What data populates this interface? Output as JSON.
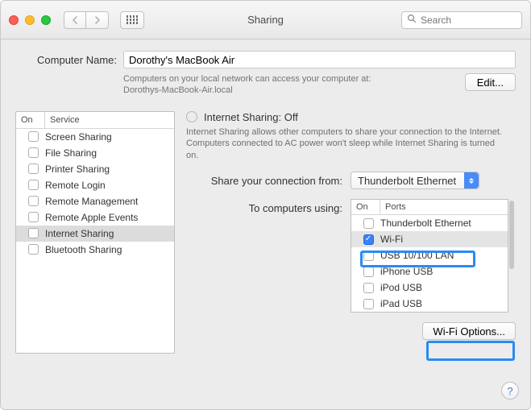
{
  "toolbar": {
    "title": "Sharing",
    "search_placeholder": "Search"
  },
  "computer_name": {
    "label": "Computer Name:",
    "value": "Dorothy's MacBook Air",
    "help1": "Computers on your local network can access your computer at:",
    "help2": "Dorothys-MacBook-Air.local",
    "edit_label": "Edit..."
  },
  "service_list": {
    "col_on": "On",
    "col_service": "Service",
    "items": [
      {
        "label": "Screen Sharing",
        "on": false,
        "selected": false
      },
      {
        "label": "File Sharing",
        "on": false,
        "selected": false
      },
      {
        "label": "Printer Sharing",
        "on": false,
        "selected": false
      },
      {
        "label": "Remote Login",
        "on": false,
        "selected": false
      },
      {
        "label": "Remote Management",
        "on": false,
        "selected": false
      },
      {
        "label": "Remote Apple Events",
        "on": false,
        "selected": false
      },
      {
        "label": "Internet Sharing",
        "on": false,
        "selected": true
      },
      {
        "label": "Bluetooth Sharing",
        "on": false,
        "selected": false
      }
    ]
  },
  "detail": {
    "title": "Internet Sharing: Off",
    "description": "Internet Sharing allows other computers to share your connection to the Internet. Computers connected to AC power won't sleep while Internet Sharing is turned on.",
    "share_from_label": "Share your connection from:",
    "share_from_value": "Thunderbolt Ethernet",
    "to_label": "To computers using:",
    "ports_col_on": "On",
    "ports_col_ports": "Ports",
    "ports": [
      {
        "label": "Thunderbolt Ethernet",
        "on": false,
        "selected": false
      },
      {
        "label": "Wi-Fi",
        "on": true,
        "selected": true
      },
      {
        "label": "USB 10/100 LAN",
        "on": false,
        "selected": false
      },
      {
        "label": "iPhone USB",
        "on": false,
        "selected": false
      },
      {
        "label": "iPod USB",
        "on": false,
        "selected": false
      },
      {
        "label": "iPad USB",
        "on": false,
        "selected": false
      }
    ],
    "wifi_options_label": "Wi-Fi Options..."
  }
}
